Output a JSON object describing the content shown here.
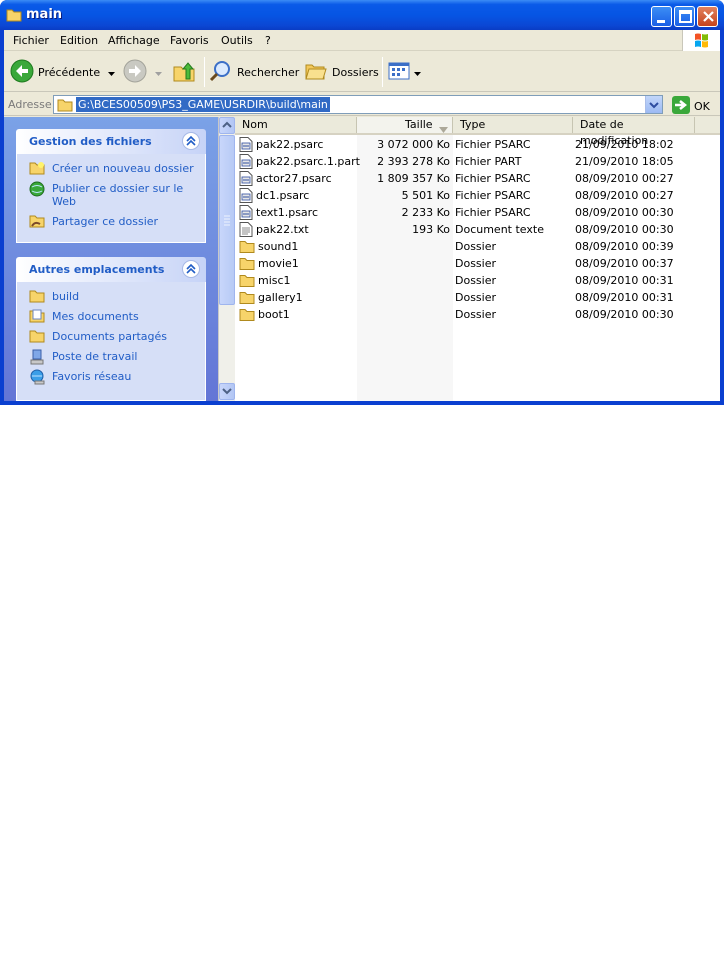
{
  "window": {
    "title": "main"
  },
  "menu": {
    "items": [
      "Fichier",
      "Edition",
      "Affichage",
      "Favoris",
      "Outils",
      "?"
    ]
  },
  "toolbar": {
    "back_label": "Précédente",
    "search_label": "Rechercher",
    "folders_label": "Dossiers"
  },
  "address": {
    "label": "Adresse",
    "path": "G:\\BCES00509\\PS3_GAME\\USRDIR\\build\\main",
    "go_label": "OK"
  },
  "tasks": {
    "file_tasks": {
      "title": "Gestion des fichiers",
      "items": [
        "Créer un nouveau dossier",
        "Publier ce dossier sur le Web",
        "Partager ce dossier"
      ]
    },
    "other_places": {
      "title": "Autres emplacements",
      "items": [
        "build",
        "Mes documents",
        "Documents partagés",
        "Poste de travail",
        "Favoris réseau"
      ]
    }
  },
  "list": {
    "columns": [
      "Nom",
      "Taille",
      "Type",
      "Date de modification"
    ],
    "rows": [
      {
        "name": "pak22.psarc",
        "size": "3 072 000 Ko",
        "type": "Fichier PSARC",
        "date": "21/09/2010 18:02",
        "icon": "file-icon"
      },
      {
        "name": "pak22.psarc.1.part",
        "size": "2 393 278 Ko",
        "type": "Fichier PART",
        "date": "21/09/2010 18:05",
        "icon": "file-icon"
      },
      {
        "name": "actor27.psarc",
        "size": "1 809 357 Ko",
        "type": "Fichier PSARC",
        "date": "08/09/2010 00:27",
        "icon": "file-icon"
      },
      {
        "name": "dc1.psarc",
        "size": "5 501 Ko",
        "type": "Fichier PSARC",
        "date": "08/09/2010 00:27",
        "icon": "file-icon"
      },
      {
        "name": "text1.psarc",
        "size": "2 233 Ko",
        "type": "Fichier PSARC",
        "date": "08/09/2010 00:30",
        "icon": "file-icon"
      },
      {
        "name": "pak22.txt",
        "size": "193 Ko",
        "type": "Document texte",
        "date": "08/09/2010 00:30",
        "icon": "text-file-icon"
      },
      {
        "name": "sound1",
        "size": "",
        "type": "Dossier",
        "date": "08/09/2010 00:39",
        "icon": "folder-icon"
      },
      {
        "name": "movie1",
        "size": "",
        "type": "Dossier",
        "date": "08/09/2010 00:37",
        "icon": "folder-icon"
      },
      {
        "name": "misc1",
        "size": "",
        "type": "Dossier",
        "date": "08/09/2010 00:31",
        "icon": "folder-icon"
      },
      {
        "name": "gallery1",
        "size": "",
        "type": "Dossier",
        "date": "08/09/2010 00:31",
        "icon": "folder-icon"
      },
      {
        "name": "boot1",
        "size": "",
        "type": "Dossier",
        "date": "08/09/2010 00:30",
        "icon": "folder-icon"
      }
    ]
  },
  "colors": {
    "title_blue": "#0a5ae8",
    "task_pane_blue": "#7ba2e7",
    "link_blue": "#215dc6",
    "selection_blue": "#316ac5"
  }
}
